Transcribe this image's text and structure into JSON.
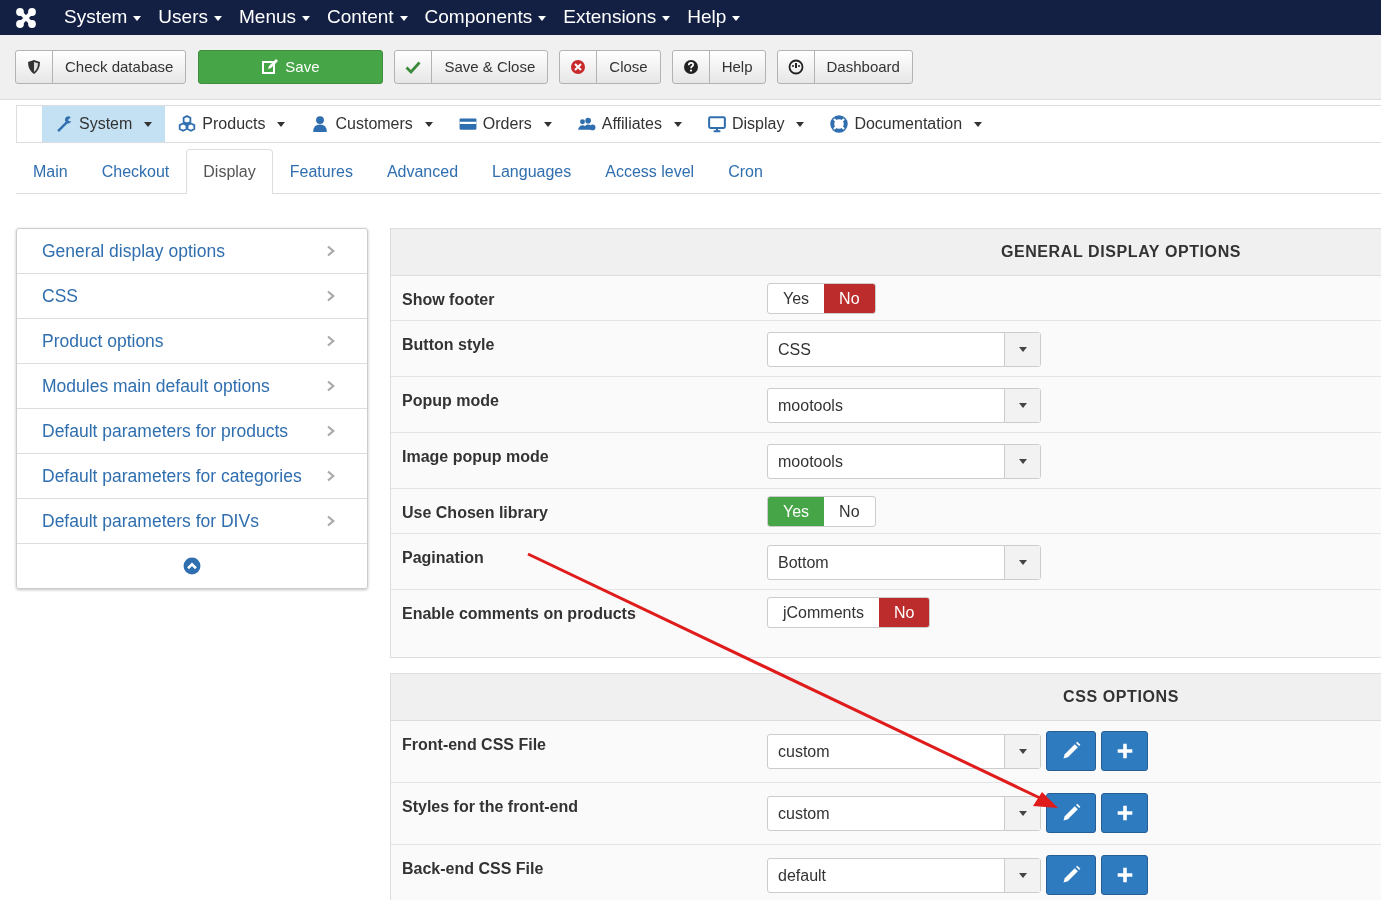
{
  "top_menu": {
    "items": [
      "System",
      "Users",
      "Menus",
      "Content",
      "Components",
      "Extensions",
      "Help"
    ]
  },
  "toolbar": {
    "buttons": [
      {
        "label": "Check database",
        "kind": "shield"
      },
      {
        "label": "Save",
        "kind": "save"
      },
      {
        "label": "Save & Close",
        "kind": "check"
      },
      {
        "label": "Close",
        "kind": "close"
      },
      {
        "label": "Help",
        "kind": "help"
      },
      {
        "label": "Dashboard",
        "kind": "dashboard"
      }
    ]
  },
  "submenu": {
    "items": [
      {
        "label": "System",
        "kind": "wrench",
        "selected": true
      },
      {
        "label": "Products",
        "kind": "cubes",
        "selected": false
      },
      {
        "label": "Customers",
        "kind": "user",
        "selected": false
      },
      {
        "label": "Orders",
        "kind": "card",
        "selected": false
      },
      {
        "label": "Affiliates",
        "kind": "users",
        "selected": false
      },
      {
        "label": "Display",
        "kind": "monitor",
        "selected": false
      },
      {
        "label": "Documentation",
        "kind": "lifebuoy",
        "selected": false
      }
    ]
  },
  "tabs": [
    {
      "label": "Main",
      "selected": false
    },
    {
      "label": "Checkout",
      "selected": false
    },
    {
      "label": "Display",
      "selected": true
    },
    {
      "label": "Features",
      "selected": false
    },
    {
      "label": "Advanced",
      "selected": false
    },
    {
      "label": "Languages",
      "selected": false
    },
    {
      "label": "Access level",
      "selected": false
    },
    {
      "label": "Cron",
      "selected": false
    }
  ],
  "sidebar": {
    "items": [
      "General display options",
      "CSS",
      "Product options",
      "Modules main default options",
      "Default parameters for products",
      "Default parameters for categories",
      "Default parameters for DIVs"
    ]
  },
  "sections": [
    {
      "title": "GENERAL DISPLAY OPTIONS",
      "rows": [
        {
          "label": "Show footer",
          "kind": "toggle",
          "options": [
            {
              "label": "Yes",
              "selected": false
            },
            {
              "label": "No",
              "selected": true
            }
          ]
        },
        {
          "label": "Button style",
          "kind": "select",
          "value": "CSS"
        },
        {
          "label": "Popup mode",
          "kind": "select",
          "value": "mootools"
        },
        {
          "label": "Image popup mode",
          "kind": "select",
          "value": "mootools"
        },
        {
          "label": "Use Chosen library",
          "kind": "toggle",
          "options": [
            {
              "label": "Yes",
              "selected": true
            },
            {
              "label": "No",
              "selected": false
            }
          ]
        },
        {
          "label": "Pagination",
          "kind": "select",
          "value": "Bottom"
        },
        {
          "label": "Enable comments on products",
          "kind": "toggle",
          "options": [
            {
              "label": "jComments",
              "selected": false
            },
            {
              "label": "No",
              "selected": true
            }
          ]
        }
      ]
    },
    {
      "title": "CSS OPTIONS",
      "rows": [
        {
          "label": "Front-end CSS File",
          "kind": "file",
          "value": "custom"
        },
        {
          "label": "Styles for the front-end",
          "kind": "file",
          "value": "custom"
        },
        {
          "label": "Back-end CSS File",
          "kind": "file",
          "value": "default"
        }
      ]
    }
  ]
}
